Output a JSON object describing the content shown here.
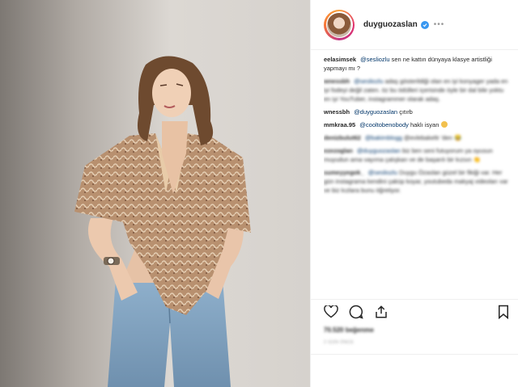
{
  "post": {
    "username": "duyguozaslan",
    "more_label": "•••",
    "likes": "70.520 beğenme",
    "time_ago": "2 GÜN ÖNCE",
    "add_comment_placeholder": ""
  },
  "comments": [
    {
      "user": "eelasimsek",
      "mention": "@sesliozlu",
      "text": "sen ne kattın dünyaya klasye artistliği yapmayı mı ?"
    },
    {
      "user": "wnessbh",
      "mention": "@sesliozlu",
      "text": "adaş gösterildiği olan en iyi konyager yada en iyi fodeyi değil zaten. öz bu ödülleri içerisinde öyle bir dal bile yoktu en iyi YouTuber, instagrammer olarak adaş."
    },
    {
      "user": "wnessbh",
      "mention": "@duyguozaslan",
      "text": "çıtırb"
    },
    {
      "user": "mmkraa.95",
      "mention": "@cooltobenobody",
      "text": "haklı isyan"
    },
    {
      "user": "denizbulut62",
      "mention": "@bakimblogg",
      "text": "@evlebakeltr 'den 😂"
    },
    {
      "user": "ezezoglan",
      "mention": "@duyguozaslan",
      "text": "biz ben seni futuyorum ya oyusun muyudun ama vayıma çalışkan ve de başarılı bir kızsın 👏"
    },
    {
      "user": "sumeyyegok_",
      "mention": "@sesliozlu",
      "text": "Duygu Özaslan güzel bir fikiği var. Her gün instagrama kendini çaküp koyar, youtubeda makyaj videoları var ve biz kızlara bunu öğretiyor."
    }
  ],
  "colors": {
    "verified": "#3897f0",
    "mention": "#003569",
    "meta": "#999999"
  },
  "icons": [
    "heart-icon",
    "comment-icon",
    "share-icon",
    "bookmark-icon",
    "verified-badge-icon"
  ]
}
